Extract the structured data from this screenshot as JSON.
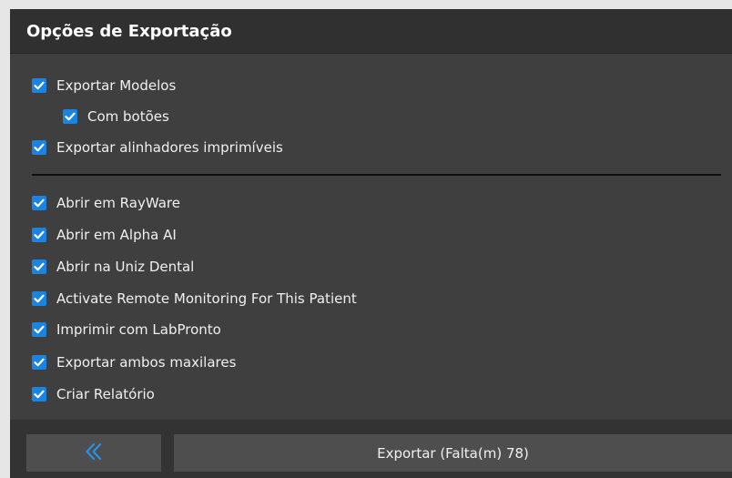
{
  "colors": {
    "accent": "#1a84e0",
    "panel_background": "#3f3f3f",
    "header_background": "#303030",
    "footer_background": "#333333",
    "button_background": "#4e4e4e",
    "back_icon_color": "#2b8ee8"
  },
  "dialog": {
    "title": "Opções de Exportação"
  },
  "options": [
    {
      "label": "Exportar Modelos",
      "checked": true
    },
    {
      "label": "Com botões",
      "checked": true
    },
    {
      "label": "Exportar alinhadores imprimíveis",
      "checked": true
    },
    {
      "label": "Abrir em RayWare",
      "checked": true
    },
    {
      "label": "Abrir em Alpha AI",
      "checked": true
    },
    {
      "label": "Abrir na Uniz Dental",
      "checked": true
    },
    {
      "label": "Activate Remote Monitoring For This Patient",
      "checked": true
    },
    {
      "label": "Imprimir com LabPronto",
      "checked": true
    },
    {
      "label": "Exportar ambos maxilares",
      "checked": true
    },
    {
      "label": "Criar Relatório",
      "checked": true
    }
  ],
  "footer": {
    "back_icon": "double-chevron-left-icon",
    "export_label": "Exportar (Falta(m) 78)"
  }
}
